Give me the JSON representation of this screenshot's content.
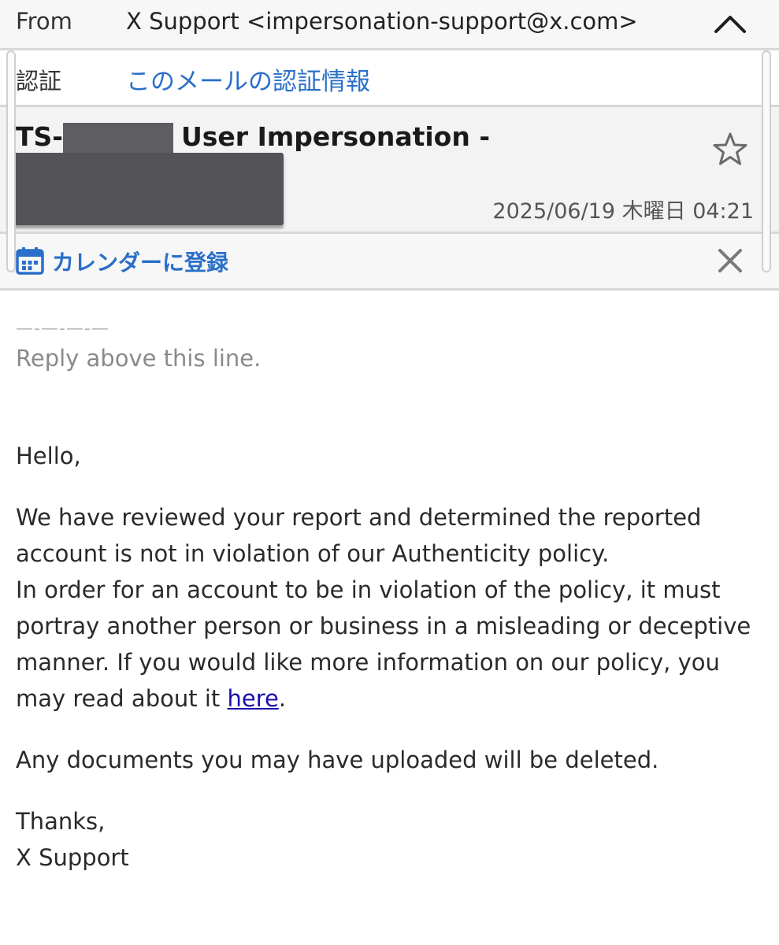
{
  "header": {
    "from_label": "From",
    "from_value": "X Support <impersonation-support@x.com>",
    "auth_label": "認証",
    "auth_link": "このメールの認証情報",
    "subject_prefix": "TS-",
    "subject_rest": "User Impersonation -",
    "date": "2025/06/19 木曜日 04:21",
    "calendar_label": "カレンダーに登録"
  },
  "body": {
    "divider": "—-—-—-—",
    "reply_above": "Reply above this line.",
    "greeting": "Hello,",
    "para1_line1": "We have reviewed your report and determined the reported account is not in violation of our Authenticity policy.",
    "para1_line2_pre": "In order for an account to be in violation of the policy, it must portray another person or business in a misleading or deceptive manner. If you would like more information on our policy, you may read about it ",
    "link_text": "here",
    "para1_line2_post": ".",
    "para2": "Any documents you may have uploaded will be deleted.",
    "closing": "Thanks,",
    "signature": "X Support"
  },
  "icons": {
    "collapse": "chevron-up-icon",
    "star": "star-outline-icon",
    "calendar": "calendar-icon",
    "close": "close-icon"
  },
  "colors": {
    "link_blue": "#2a6fc9",
    "hyperlink": "#1a0dab",
    "redaction": "#545458"
  }
}
